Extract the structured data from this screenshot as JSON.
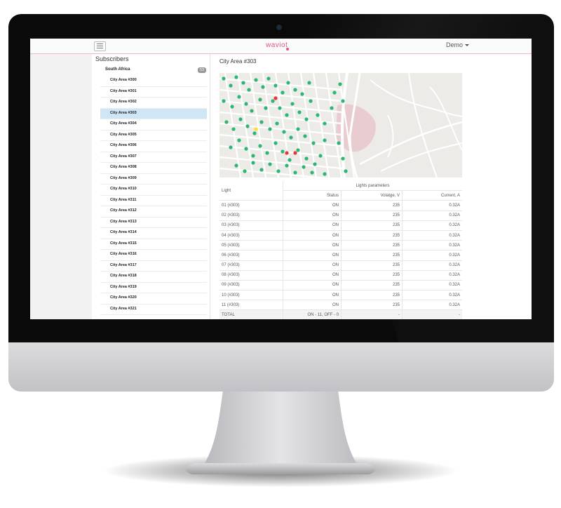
{
  "app": {
    "brand": "waviot",
    "user_menu": "Demo"
  },
  "sidebar": {
    "title": "Subscribers",
    "region": {
      "label": "South Africa",
      "badge": "53"
    },
    "items": [
      {
        "label": "City Area #300"
      },
      {
        "label": "City Area #301"
      },
      {
        "label": "City Area #302"
      },
      {
        "label": "City Area #303",
        "active": true
      },
      {
        "label": "City Area #304"
      },
      {
        "label": "City Area #305"
      },
      {
        "label": "City Area #306"
      },
      {
        "label": "City Area #307"
      },
      {
        "label": "City Area #308"
      },
      {
        "label": "City Area #309"
      },
      {
        "label": "City Area #310"
      },
      {
        "label": "City Area #311"
      },
      {
        "label": "City Area #312"
      },
      {
        "label": "City Area #313"
      },
      {
        "label": "City Area #314"
      },
      {
        "label": "City Area #315"
      },
      {
        "label": "City Area #316"
      },
      {
        "label": "City Area #317"
      },
      {
        "label": "City Area #318"
      },
      {
        "label": "City Area #319"
      },
      {
        "label": "City Area #320"
      },
      {
        "label": "City Area #321"
      }
    ]
  },
  "main": {
    "title": "City Area #303",
    "map": {
      "colors": {
        "ok": "#2bb673",
        "fault": "#e8343a",
        "warning": "#f5e03a"
      }
    },
    "table": {
      "col_light": "Light",
      "group_header": "Lights parameters",
      "col_status": "Status",
      "col_voltage": "Volatge, V",
      "col_current": "Current, A",
      "rows": [
        {
          "light": "01 (#303)",
          "status": "ON",
          "voltage": "235",
          "current": "0.32A"
        },
        {
          "light": "02 (#303)",
          "status": "ON",
          "voltage": "235",
          "current": "0.32A"
        },
        {
          "light": "03 (#303)",
          "status": "ON",
          "voltage": "235",
          "current": "0.32A"
        },
        {
          "light": "04 (#303)",
          "status": "ON",
          "voltage": "235",
          "current": "0.32A"
        },
        {
          "light": "05 (#303)",
          "status": "ON",
          "voltage": "235",
          "current": "0.32A"
        },
        {
          "light": "06 (#303)",
          "status": "ON",
          "voltage": "235",
          "current": "0.32A"
        },
        {
          "light": "07 (#303)",
          "status": "ON",
          "voltage": "235",
          "current": "0.32A"
        },
        {
          "light": "08 (#303)",
          "status": "ON",
          "voltage": "235",
          "current": "0.32A"
        },
        {
          "light": "09 (#303)",
          "status": "ON",
          "voltage": "235",
          "current": "0.32A"
        },
        {
          "light": "10 (#303)",
          "status": "ON",
          "voltage": "235",
          "current": "0.32A"
        },
        {
          "light": "11 (#303)",
          "status": "ON",
          "voltage": "235",
          "current": "0.32A"
        }
      ],
      "total": {
        "light": "TOTAL",
        "status": "ON - 11, OFF - 0",
        "voltage": "-",
        "current": "-"
      }
    }
  }
}
